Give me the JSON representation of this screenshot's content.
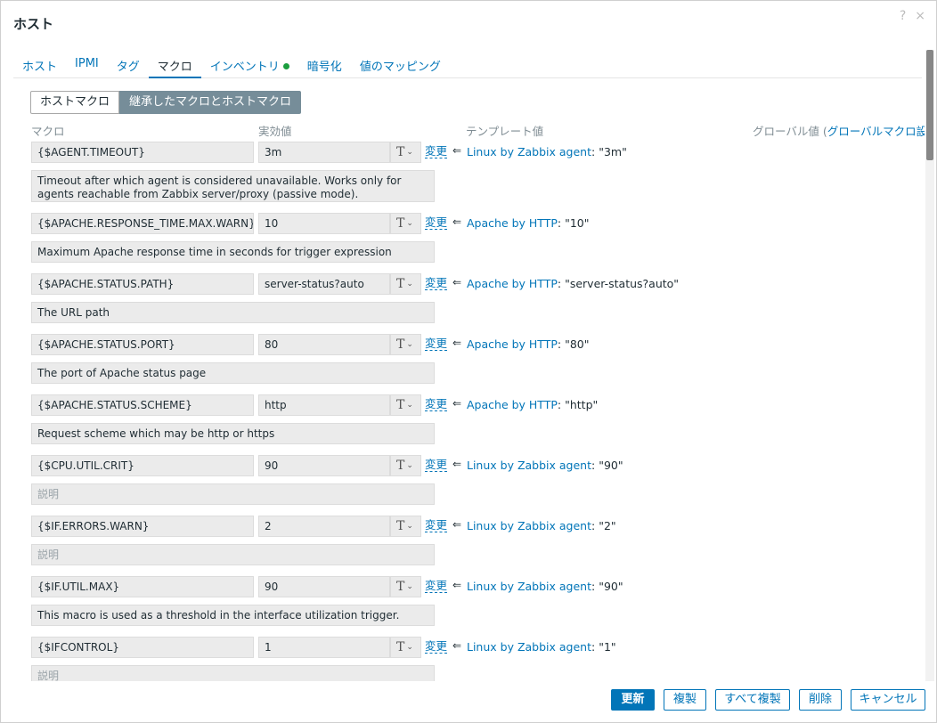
{
  "dialog": {
    "title": "ホスト",
    "help_icon": "?",
    "close_icon": "×"
  },
  "tabs": [
    {
      "label": "ホスト",
      "active": false
    },
    {
      "label": "IPMI",
      "active": false
    },
    {
      "label": "タグ",
      "active": false
    },
    {
      "label": "マクロ",
      "active": true
    },
    {
      "label": "インベントリ",
      "active": false,
      "status_dot_color": "#1b9e3e"
    },
    {
      "label": "暗号化",
      "active": false
    },
    {
      "label": "値のマッピング",
      "active": false
    }
  ],
  "macro_mode": {
    "host_macros_label": "ホストマクロ",
    "inherited_label": "継承したマクロとホストマクロ",
    "selected": "継承したマクロとホストマクロ"
  },
  "columns": {
    "macro": "マクロ",
    "effective_value": "実効値",
    "template_value": "テンプレート値",
    "global_value": "グローバル値 (",
    "global_link": "グローバルマクロ設定"
  },
  "change_label": "変更",
  "type_icon": "T",
  "arrow_glyph": "⇐",
  "description_placeholder": "説明",
  "macros": [
    {
      "macro": "{$AGENT.TIMEOUT}",
      "value": "3m",
      "template": "Linux by Zabbix agent",
      "template_value": ": \"3m\"",
      "description": "Timeout after which agent is considered unavailable. Works only for agents reachable from Zabbix server/proxy (passive mode)."
    },
    {
      "macro": "{$APACHE.RESPONSE_TIME.MAX.WARN}",
      "value": "10",
      "template": "Apache by HTTP",
      "template_value": ": \"10\"",
      "description": "Maximum Apache response time in seconds for trigger expression"
    },
    {
      "macro": "{$APACHE.STATUS.PATH}",
      "value": "server-status?auto",
      "template": "Apache by HTTP",
      "template_value": ": \"server-status?auto\"",
      "description": "The URL path"
    },
    {
      "macro": "{$APACHE.STATUS.PORT}",
      "value": "80",
      "template": "Apache by HTTP",
      "template_value": ": \"80\"",
      "description": "The port of Apache status page"
    },
    {
      "macro": "{$APACHE.STATUS.SCHEME}",
      "value": "http",
      "template": "Apache by HTTP",
      "template_value": ": \"http\"",
      "description": "Request scheme which may be http or https"
    },
    {
      "macro": "{$CPU.UTIL.CRIT}",
      "value": "90",
      "template": "Linux by Zabbix agent",
      "template_value": ": \"90\"",
      "description": ""
    },
    {
      "macro": "{$IF.ERRORS.WARN}",
      "value": "2",
      "template": "Linux by Zabbix agent",
      "template_value": ": \"2\"",
      "description": ""
    },
    {
      "macro": "{$IF.UTIL.MAX}",
      "value": "90",
      "template": "Linux by Zabbix agent",
      "template_value": ": \"90\"",
      "description": "This macro is used as a threshold in the interface utilization trigger."
    },
    {
      "macro": "{$IFCONTROL}",
      "value": "1",
      "template": "Linux by Zabbix agent",
      "template_value": ": \"1\"",
      "description": ""
    }
  ],
  "footer": {
    "update": "更新",
    "clone": "複製",
    "full_clone": "すべて複製",
    "delete": "削除",
    "cancel": "キャンセル"
  },
  "colors": {
    "accent": "#0275b8",
    "segment_active": "#768d99",
    "field_bg": "#ebebeb"
  }
}
